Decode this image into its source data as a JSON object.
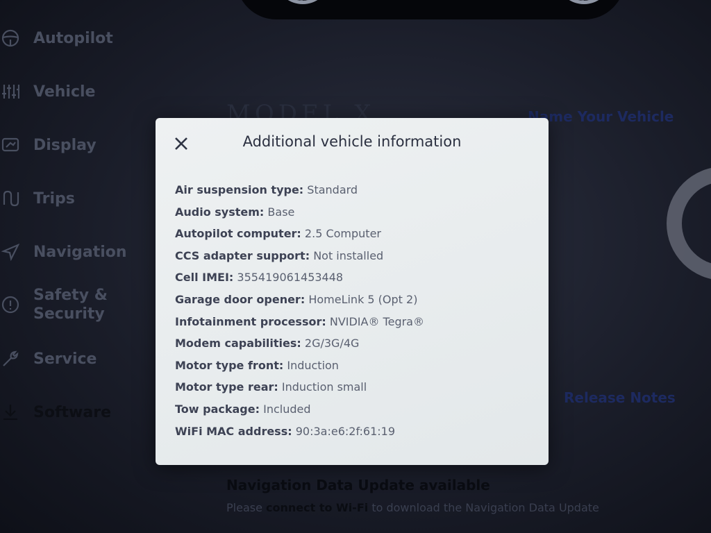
{
  "sidebar": {
    "items": [
      {
        "label": "Autopilot",
        "icon": "steering-wheel-icon"
      },
      {
        "label": "Vehicle",
        "icon": "sliders-icon"
      },
      {
        "label": "Display",
        "icon": "display-icon"
      },
      {
        "label": "Trips",
        "icon": "trips-icon"
      },
      {
        "label": "Navigation",
        "icon": "navigation-arrow-icon"
      },
      {
        "label": "Safety & Security",
        "icon": "alert-circle-icon"
      },
      {
        "label": "Service",
        "icon": "wrench-icon"
      },
      {
        "label": "Software",
        "icon": "download-icon"
      }
    ],
    "active": "Software"
  },
  "main": {
    "model_logo": "MODEL X",
    "name_vehicle_link": "Name Your Vehicle",
    "release_notes_link": "Release Notes",
    "nav_update_title": "Navigation Data Update available",
    "nav_update_prefix": "Please ",
    "nav_update_link": "connect to Wi-Fi",
    "nav_update_suffix": " to download the Navigation Data Update"
  },
  "modal": {
    "title": "Additional vehicle information",
    "close_icon": "close-icon",
    "rows": [
      {
        "key": "Air suspension type:",
        "value": "Standard"
      },
      {
        "key": "Audio system:",
        "value": "Base"
      },
      {
        "key": "Autopilot computer:",
        "value": "2.5 Computer"
      },
      {
        "key": "CCS adapter support:",
        "value": "Not installed"
      },
      {
        "key": "Cell IMEI:",
        "value": "355419061453448"
      },
      {
        "key": "Garage door opener:",
        "value": "HomeLink 5 (Opt 2)"
      },
      {
        "key": "Infotainment processor:",
        "value": "NVIDIA® Tegra®"
      },
      {
        "key": "Modem capabilities:",
        "value": "2G/3G/4G"
      },
      {
        "key": "Motor type front:",
        "value": "Induction"
      },
      {
        "key": "Motor type rear:",
        "value": "Induction small"
      },
      {
        "key": "Tow package:",
        "value": "Included"
      },
      {
        "key": "WiFi MAC address:",
        "value": "90:3a:e6:2f:61:19"
      }
    ]
  },
  "colors": {
    "modal_bg": "#e8ecee",
    "sidebar_text": "#494f60",
    "link_blue": "#1d2a60"
  }
}
